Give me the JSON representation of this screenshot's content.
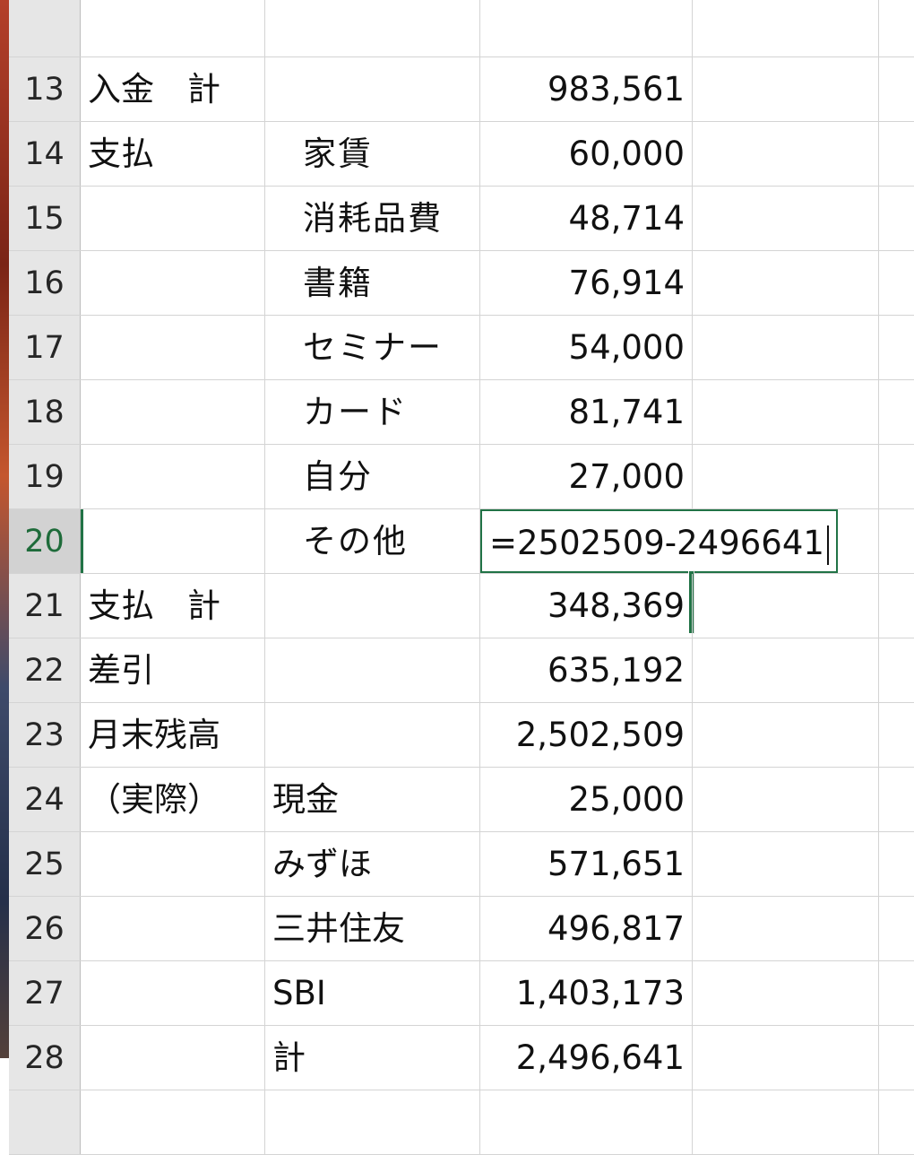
{
  "rows": [
    {
      "num": "13",
      "a": "入金　計",
      "b": "",
      "c": "983,561"
    },
    {
      "num": "14",
      "a": "支払",
      "b": "家賃",
      "c": "60,000"
    },
    {
      "num": "15",
      "a": "",
      "b": "消耗品費",
      "c": "48,714"
    },
    {
      "num": "16",
      "a": "",
      "b": "書籍",
      "c": "76,914"
    },
    {
      "num": "17",
      "a": "",
      "b": "セミナー",
      "c": "54,000"
    },
    {
      "num": "18",
      "a": "",
      "b": "カード",
      "c": "81,741"
    },
    {
      "num": "19",
      "a": "",
      "b": "自分",
      "c": "27,000"
    },
    {
      "num": "20",
      "a": "",
      "b": "その他",
      "c": "=2502509-2496641"
    },
    {
      "num": "21",
      "a": "支払　計",
      "b": "",
      "c": "348,369"
    },
    {
      "num": "22",
      "a": "差引",
      "b": "",
      "c": "635,192"
    },
    {
      "num": "23",
      "a": "月末残高",
      "b": "",
      "c": "2,502,509"
    },
    {
      "num": "24",
      "a": "（実際）",
      "b": "現金",
      "c": "25,000"
    },
    {
      "num": "25",
      "a": "",
      "b": "みずほ",
      "c": "571,651"
    },
    {
      "num": "26",
      "a": "",
      "b": "三井住友",
      "c": "496,817"
    },
    {
      "num": "27",
      "a": "",
      "b": "SBI",
      "c": "1,403,173"
    },
    {
      "num": "28",
      "a": "",
      "b": "計",
      "c": "2,496,641"
    }
  ],
  "active_row": "20",
  "colors": {
    "accent": "#217346",
    "grid": "#d4d4d4",
    "header_bg": "#e6e6e6"
  }
}
